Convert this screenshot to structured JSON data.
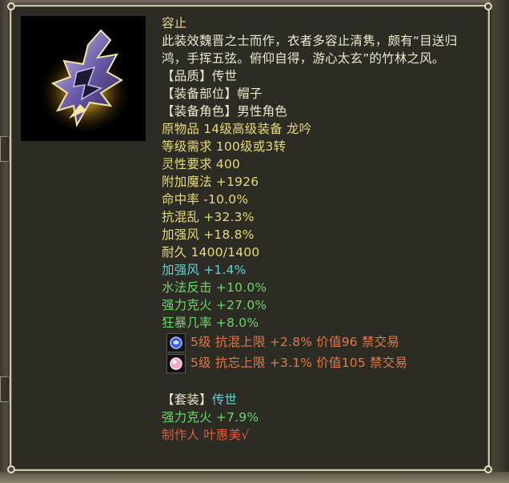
{
  "item": {
    "name": "容止",
    "description": "此装效魏晋之士而作，衣者多容止清隽，颇有“目送归鸿，手挥五弦。俯仰自得，游心太玄”的竹林之风。",
    "icon": "hat-equipment-icon",
    "quality_line": "【品质】传世",
    "slot_line": "【装备部位】帽子",
    "role_line": "【装备角色】男性角色",
    "base_stats": [
      "原物品 14级高级装备 龙吟",
      "等级需求 100级或3转",
      "灵性要求 400",
      "附加魔法 +1926",
      "命中率 -10.0%",
      "抗混乱 +32.3%",
      "加强风 +18.8%",
      "耐久 1400/1400"
    ],
    "special_stat": "加强风 +1.4%",
    "bonus_stats": [
      "水法反击 +10.0%",
      "强力克火 +27.0%",
      "狂暴几率 +8.0%"
    ],
    "gems": [
      {
        "icon": "blue-gem-icon",
        "text": "5级 抗混上限 +2.8% 价值96 禁交易"
      },
      {
        "icon": "pink-gem-icon",
        "text": "5级 抗忘上限 +3.1% 价值105 禁交易"
      }
    ],
    "set": {
      "prefix": "【套装】",
      "name": "传世",
      "bonus": "强力克火 +7.9%"
    },
    "maker": "制作人 叶惠美√"
  },
  "colors": {
    "panel_bg": "#2c2b24",
    "border": "#cfc6a6",
    "name": "#ead98a",
    "attribute": "#e6db79",
    "cyan": "#5fd2d6",
    "green": "#6cd76a",
    "gem_text": "#e07a4a",
    "maker": "#e05a3c"
  }
}
